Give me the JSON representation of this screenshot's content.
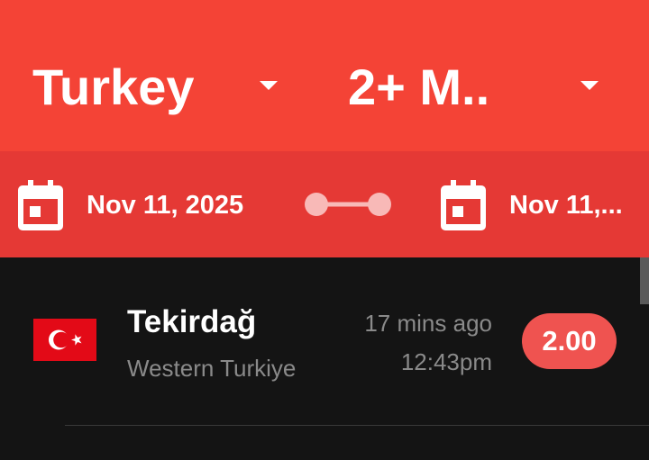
{
  "filters": {
    "country": "Turkey",
    "magnitude": "2+ M.."
  },
  "dates": {
    "start": "Nov 11, 2025",
    "end": "Nov 11,..."
  },
  "colors": {
    "primary": "#f44336",
    "date_bar": "#e53935",
    "badge": "#ef5350",
    "background": "#141414",
    "secondary_text": "#8a8a8a"
  },
  "icons": {
    "calendar": "calendar-icon",
    "dropdown": "chevron-down-icon",
    "range": "range-slider-icon",
    "flag": "turkey-flag-icon"
  },
  "quakes": [
    {
      "place": "Tekirdağ",
      "region": "Western Turkiye",
      "ago": "17 mins ago",
      "time": "12:43pm",
      "magnitude": "2.00"
    }
  ]
}
